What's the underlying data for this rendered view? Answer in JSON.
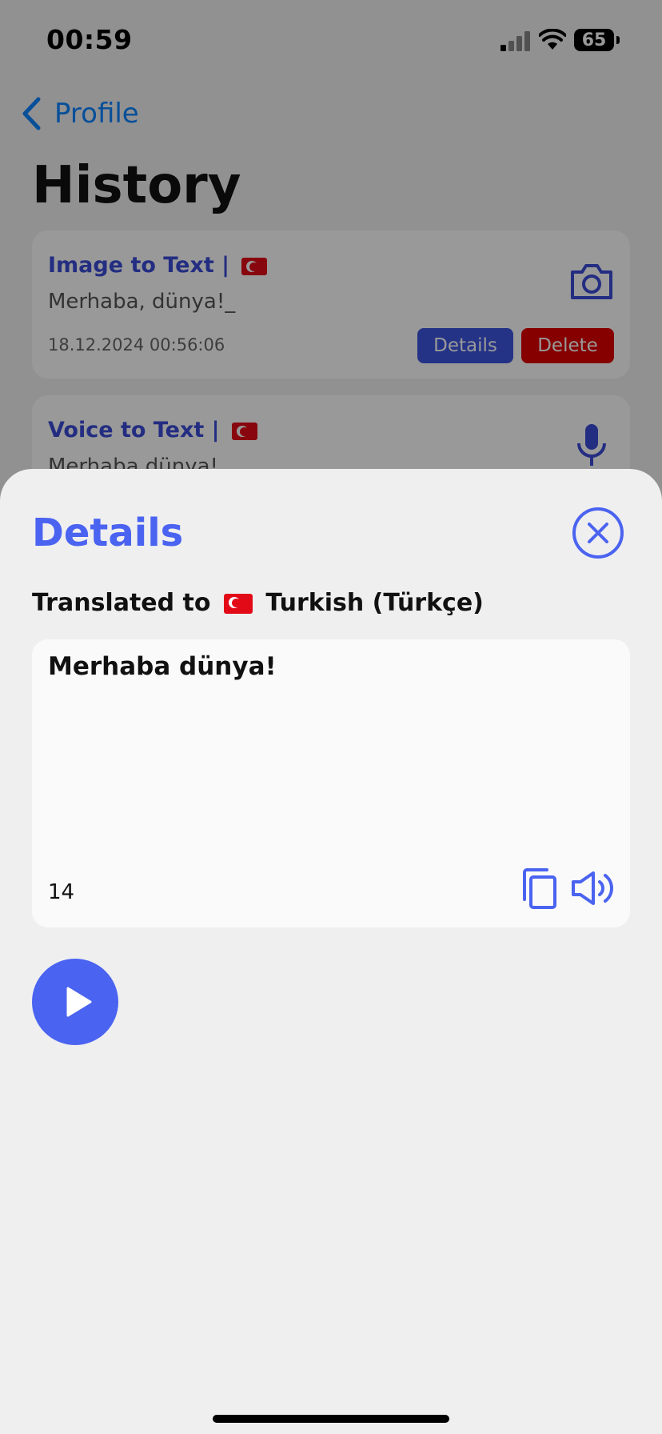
{
  "status_bar": {
    "time": "00:59",
    "battery": "65"
  },
  "nav": {
    "back_label": "Profile"
  },
  "page": {
    "title": "History"
  },
  "history": [
    {
      "title": "Image to Text |",
      "text": "Merhaba, dünya!_",
      "date": "18.12.2024 00:56:06",
      "details_label": "Details",
      "delete_label": "Delete",
      "icon": "camera-icon"
    },
    {
      "title": "Voice to Text |",
      "text": "Merhaba dünya!",
      "icon": "microphone-icon"
    }
  ],
  "sheet": {
    "title": "Details",
    "translated_prefix": "Translated to",
    "language": "Turkish (Türkçe)",
    "result_text": "Merhaba dünya!",
    "char_count": "14",
    "icons": [
      "close-icon",
      "copy-icon",
      "speaker-icon",
      "play-icon"
    ]
  },
  "colors": {
    "accent": "#4a63f0",
    "link": "#0a84ff",
    "delete": "#e00000",
    "details_button": "#3d55e0"
  }
}
